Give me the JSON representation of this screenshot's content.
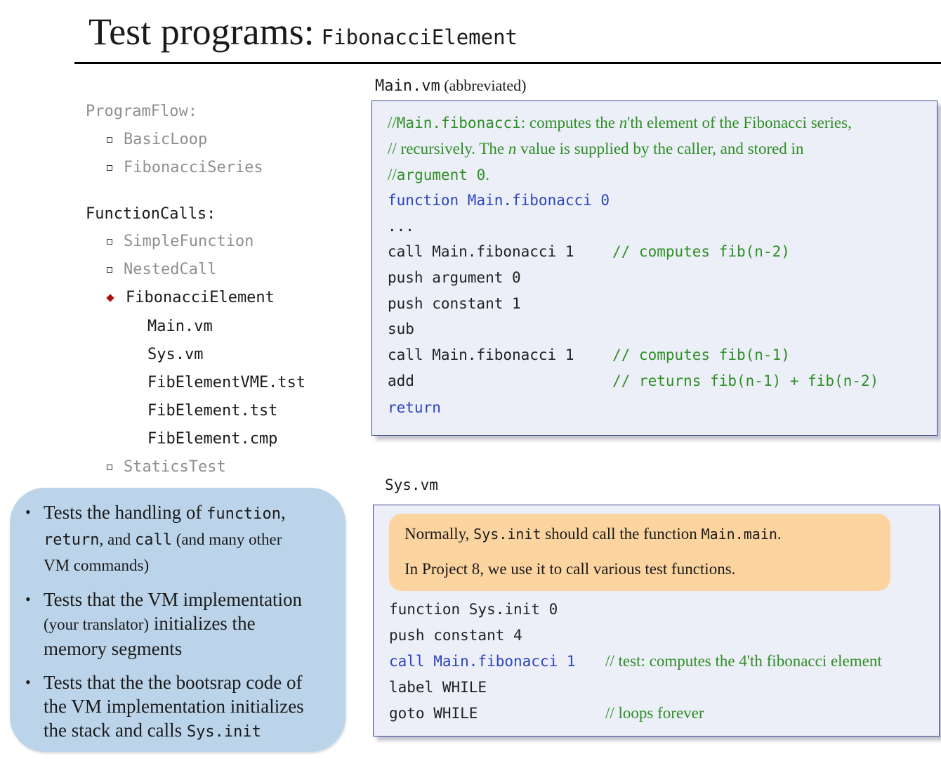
{
  "title": {
    "main": "Test programs:",
    "sub": "FibonacciElement"
  },
  "tree": {
    "program_flow": {
      "label": "ProgramFlow:",
      "items": [
        "BasicLoop",
        "FibonacciSeries"
      ]
    },
    "function_calls": {
      "label": "FunctionCalls:",
      "items": [
        "SimpleFunction",
        "NestedCall",
        "FibonacciElement"
      ],
      "files": [
        "Main.vm",
        "Sys.vm",
        "FibElementVME.tst",
        "FibElement.tst",
        "FibElement.cmp"
      ],
      "last": "StaticsTest"
    }
  },
  "notes": [
    {
      "a": "Tests the handling of ",
      "b": "function",
      "c": ",",
      "d": "return",
      "e": ", and ",
      "f": "call",
      "g": " (and many other",
      "h": "VM commands)"
    },
    {
      "a": "Tests that the VM implementation",
      "b": "(your translator)",
      "c": " initializes the",
      "d": "memory segments"
    },
    {
      "a": "Tests that the the bootsrap code of",
      "b": "the VM implementation initializes",
      "c": "the stack and calls ",
      "d": "Sys.init"
    }
  ],
  "main_vm": {
    "filename": "Main.vm",
    "label_suffix": "(abbreviated)",
    "comment1": {
      "slashes": "//",
      "mono": "Main.fibonacci",
      "t1": ": computes the ",
      "n": "n",
      "t2": "'th element of the Fibonacci series,"
    },
    "comment2": {
      "slashes": "//",
      "t1": " recursively. The ",
      "n": "n",
      "t2": " value is supplied by the caller, and stored in"
    },
    "comment3": {
      "slashes": "//",
      "mono": "argument 0",
      "t1": "."
    },
    "lines": [
      {
        "code": "function Main.fibonacci 0",
        "comment": ""
      },
      {
        "code": "...",
        "comment": ""
      },
      {
        "code": "call Main.fibonacci 1",
        "comment": "// computes fib(n-2)"
      },
      {
        "code": "push argument 0",
        "comment": ""
      },
      {
        "code": "push constant 1",
        "comment": ""
      },
      {
        "code": "sub",
        "comment": ""
      },
      {
        "code": "call Main.fibonacci 1",
        "comment": "// computes fib(n-1)"
      },
      {
        "code": "add",
        "comment": "// returns fib(n-1) + fib(n-2)"
      },
      {
        "code": "return",
        "comment": ""
      }
    ]
  },
  "sys_vm": {
    "filename": "Sys.vm",
    "note": {
      "l1a": "Normally, ",
      "l1b": "Sys.init",
      "l1c": " should call the function ",
      "l1d": "Main.main",
      "l1e": ".",
      "l2": "In Project 8, we use it to call various test functions."
    },
    "lines": [
      {
        "code": "function Sys.init 0",
        "comment": ""
      },
      {
        "code": "push constant 4",
        "comment": ""
      },
      {
        "code": "call Main.fibonacci 1",
        "comment": "// test: computes the 4'th fibonacci element"
      },
      {
        "code": "label WHILE",
        "comment": ""
      },
      {
        "code": "goto WHILE",
        "comment": "// loops forever"
      }
    ]
  },
  "colors": {
    "comment": "#2e8f24",
    "keyword": "#2a45c0",
    "note_bg": "#bcd4ea",
    "sys_note_bg": "#fcd4a0",
    "code_bg": "#eceef8"
  }
}
